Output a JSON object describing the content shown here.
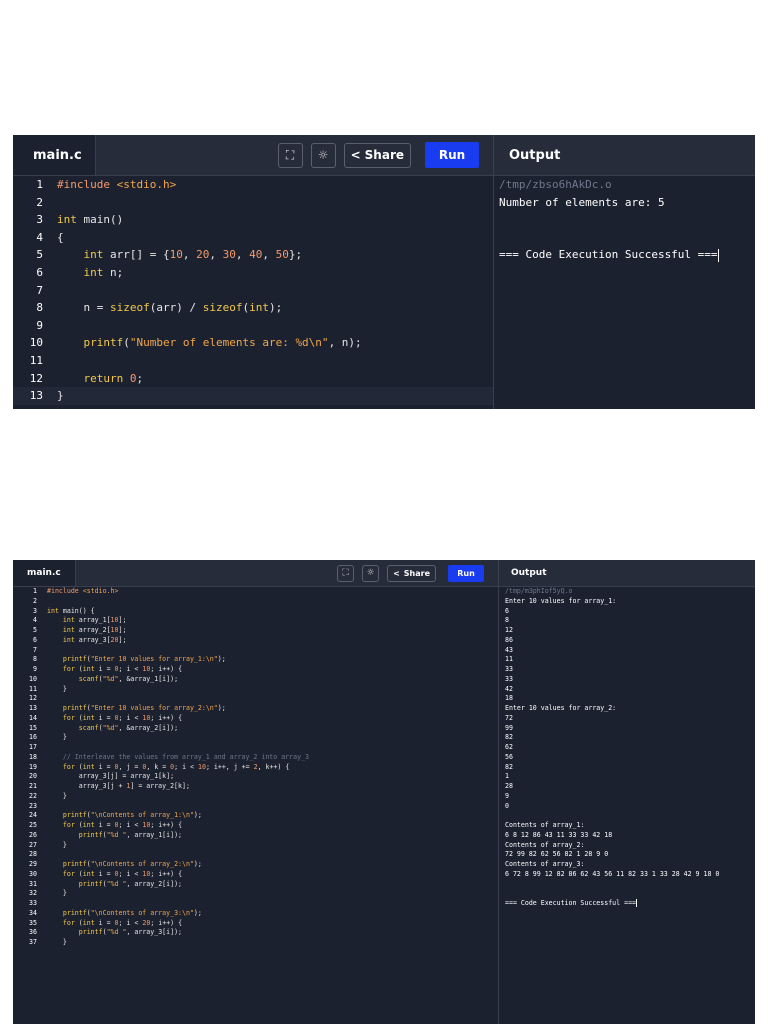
{
  "screenshot_1": {
    "file_tab": "main.c",
    "fullscreen_icon": "⛶",
    "theme_icon": "☼",
    "share_label": "Share",
    "run_label": "Run",
    "output_title": "Output",
    "code": [
      {
        "n": "1",
        "t": [
          [
            "inc",
            "#include "
          ],
          [
            "str",
            "<stdio.h>"
          ]
        ]
      },
      {
        "n": "2",
        "t": []
      },
      {
        "n": "3",
        "t": [
          [
            "kw",
            "int "
          ],
          [
            "code",
            "main()"
          ]
        ]
      },
      {
        "n": "4",
        "t": [
          [
            "code",
            "{"
          ]
        ]
      },
      {
        "n": "5",
        "t": [
          [
            "code",
            "    "
          ],
          [
            "kw",
            "int "
          ],
          [
            "code",
            "arr[] = {"
          ],
          [
            "num",
            "10"
          ],
          [
            "code",
            ", "
          ],
          [
            "num",
            "20"
          ],
          [
            "code",
            ", "
          ],
          [
            "num",
            "30"
          ],
          [
            "code",
            ", "
          ],
          [
            "num",
            "40"
          ],
          [
            "code",
            ", "
          ],
          [
            "num",
            "50"
          ],
          [
            "code",
            "};"
          ]
        ]
      },
      {
        "n": "6",
        "t": [
          [
            "code",
            "    "
          ],
          [
            "kw",
            "int "
          ],
          [
            "code",
            "n;"
          ]
        ]
      },
      {
        "n": "7",
        "t": []
      },
      {
        "n": "8",
        "t": [
          [
            "code",
            "    n = "
          ],
          [
            "kw",
            "sizeof"
          ],
          [
            "code",
            "(arr) / "
          ],
          [
            "kw",
            "sizeof"
          ],
          [
            "code",
            "("
          ],
          [
            "kw",
            "int"
          ],
          [
            "code",
            ");"
          ]
        ]
      },
      {
        "n": "9",
        "t": []
      },
      {
        "n": "10",
        "t": [
          [
            "code",
            "    "
          ],
          [
            "kw",
            "printf"
          ],
          [
            "code",
            "("
          ],
          [
            "str",
            "\"Number of elements are: %d\\n\""
          ],
          [
            "code",
            ", n);"
          ]
        ]
      },
      {
        "n": "11",
        "t": []
      },
      {
        "n": "12",
        "t": [
          [
            "code",
            "    "
          ],
          [
            "kw",
            "return "
          ],
          [
            "num",
            "0"
          ],
          [
            "code",
            ";"
          ]
        ]
      },
      {
        "n": "13",
        "t": [
          [
            "code",
            "}"
          ]
        ]
      }
    ],
    "output": [
      {
        "t": "/tmp/zbso6hAkDc.o",
        "path": true
      },
      {
        "t": "Number of elements are: 5"
      },
      {
        "t": ""
      },
      {
        "t": ""
      },
      {
        "t": "=== Code Execution Successful ===",
        "cursor": true
      }
    ]
  },
  "screenshot_2": {
    "file_tab": "main.c",
    "fullscreen_icon": "⛶",
    "theme_icon": "☼",
    "share_label": "Share",
    "run_label": "Run",
    "output_title": "Output",
    "code": [
      {
        "n": "1",
        "t": [
          [
            "inc",
            "#include "
          ],
          [
            "str",
            "<stdio.h>"
          ]
        ]
      },
      {
        "n": "2",
        "t": []
      },
      {
        "n": "3",
        "t": [
          [
            "kw",
            "int "
          ],
          [
            "code",
            "main() {"
          ]
        ]
      },
      {
        "n": "4",
        "t": [
          [
            "code",
            "    "
          ],
          [
            "kw",
            "int "
          ],
          [
            "code",
            "array_1["
          ],
          [
            "num",
            "10"
          ],
          [
            "code",
            "];"
          ]
        ]
      },
      {
        "n": "5",
        "t": [
          [
            "code",
            "    "
          ],
          [
            "kw",
            "int "
          ],
          [
            "code",
            "array_2["
          ],
          [
            "num",
            "10"
          ],
          [
            "code",
            "];"
          ]
        ]
      },
      {
        "n": "6",
        "t": [
          [
            "code",
            "    "
          ],
          [
            "kw",
            "int "
          ],
          [
            "code",
            "array_3["
          ],
          [
            "num",
            "20"
          ],
          [
            "code",
            "];"
          ]
        ]
      },
      {
        "n": "7",
        "t": []
      },
      {
        "n": "8",
        "t": [
          [
            "code",
            "    "
          ],
          [
            "kw",
            "printf"
          ],
          [
            "code",
            "("
          ],
          [
            "str",
            "\"Enter 10 values for array_1:\\n\""
          ],
          [
            "code",
            ");"
          ]
        ]
      },
      {
        "n": "9",
        "t": [
          [
            "code",
            "    "
          ],
          [
            "kw",
            "for "
          ],
          [
            "code",
            "("
          ],
          [
            "kw",
            "int "
          ],
          [
            "code",
            "i = "
          ],
          [
            "num",
            "0"
          ],
          [
            "code",
            "; i < "
          ],
          [
            "num",
            "10"
          ],
          [
            "code",
            "; i++) {"
          ]
        ]
      },
      {
        "n": "10",
        "t": [
          [
            "code",
            "        "
          ],
          [
            "kw",
            "scanf"
          ],
          [
            "code",
            "("
          ],
          [
            "str",
            "\"%d\""
          ],
          [
            "code",
            ", &array_1[i]);"
          ]
        ]
      },
      {
        "n": "11",
        "t": [
          [
            "code",
            "    }"
          ]
        ]
      },
      {
        "n": "12",
        "t": []
      },
      {
        "n": "13",
        "t": [
          [
            "code",
            "    "
          ],
          [
            "kw",
            "printf"
          ],
          [
            "code",
            "("
          ],
          [
            "str",
            "\"Enter 10 values for array_2:\\n\""
          ],
          [
            "code",
            ");"
          ]
        ]
      },
      {
        "n": "14",
        "t": [
          [
            "code",
            "    "
          ],
          [
            "kw",
            "for "
          ],
          [
            "code",
            "("
          ],
          [
            "kw",
            "int "
          ],
          [
            "code",
            "i = "
          ],
          [
            "num",
            "0"
          ],
          [
            "code",
            "; i < "
          ],
          [
            "num",
            "10"
          ],
          [
            "code",
            "; i++) {"
          ]
        ]
      },
      {
        "n": "15",
        "t": [
          [
            "code",
            "        "
          ],
          [
            "kw",
            "scanf"
          ],
          [
            "code",
            "("
          ],
          [
            "str",
            "\"%d\""
          ],
          [
            "code",
            ", &array_2[i]);"
          ]
        ]
      },
      {
        "n": "16",
        "t": [
          [
            "code",
            "    }"
          ]
        ]
      },
      {
        "n": "17",
        "t": []
      },
      {
        "n": "18",
        "t": [
          [
            "com",
            "    // Interleave the values from array_1 and array_2 into array_3"
          ]
        ]
      },
      {
        "n": "19",
        "t": [
          [
            "code",
            "    "
          ],
          [
            "kw",
            "for "
          ],
          [
            "code",
            "("
          ],
          [
            "kw",
            "int "
          ],
          [
            "code",
            "i = "
          ],
          [
            "num",
            "0"
          ],
          [
            "code",
            ", j = "
          ],
          [
            "num",
            "0"
          ],
          [
            "code",
            ", k = "
          ],
          [
            "num",
            "0"
          ],
          [
            "code",
            "; i < "
          ],
          [
            "num",
            "10"
          ],
          [
            "code",
            "; i++, j += "
          ],
          [
            "num",
            "2"
          ],
          [
            "code",
            ", k++) {"
          ]
        ]
      },
      {
        "n": "20",
        "t": [
          [
            "code",
            "        array_3[j] = array_1[k];"
          ]
        ]
      },
      {
        "n": "21",
        "t": [
          [
            "code",
            "        array_3[j + "
          ],
          [
            "num",
            "1"
          ],
          [
            "code",
            "] = array_2[k];"
          ]
        ]
      },
      {
        "n": "22",
        "t": [
          [
            "code",
            "    }"
          ]
        ]
      },
      {
        "n": "23",
        "t": []
      },
      {
        "n": "24",
        "t": [
          [
            "code",
            "    "
          ],
          [
            "kw",
            "printf"
          ],
          [
            "code",
            "("
          ],
          [
            "str",
            "\"\\nContents of array_1:\\n\""
          ],
          [
            "code",
            ");"
          ]
        ]
      },
      {
        "n": "25",
        "t": [
          [
            "code",
            "    "
          ],
          [
            "kw",
            "for "
          ],
          [
            "code",
            "("
          ],
          [
            "kw",
            "int "
          ],
          [
            "code",
            "i = "
          ],
          [
            "num",
            "0"
          ],
          [
            "code",
            "; i < "
          ],
          [
            "num",
            "10"
          ],
          [
            "code",
            "; i++) {"
          ]
        ]
      },
      {
        "n": "26",
        "t": [
          [
            "code",
            "        "
          ],
          [
            "kw",
            "printf"
          ],
          [
            "code",
            "("
          ],
          [
            "str",
            "\"%d \""
          ],
          [
            "code",
            ", array_1[i]);"
          ]
        ]
      },
      {
        "n": "27",
        "t": [
          [
            "code",
            "    }"
          ]
        ]
      },
      {
        "n": "28",
        "t": []
      },
      {
        "n": "29",
        "t": [
          [
            "code",
            "    "
          ],
          [
            "kw",
            "printf"
          ],
          [
            "code",
            "("
          ],
          [
            "str",
            "\"\\nContents of array_2:\\n\""
          ],
          [
            "code",
            ");"
          ]
        ]
      },
      {
        "n": "30",
        "t": [
          [
            "code",
            "    "
          ],
          [
            "kw",
            "for "
          ],
          [
            "code",
            "("
          ],
          [
            "kw",
            "int "
          ],
          [
            "code",
            "i = "
          ],
          [
            "num",
            "0"
          ],
          [
            "code",
            "; i < "
          ],
          [
            "num",
            "10"
          ],
          [
            "code",
            "; i++) {"
          ]
        ]
      },
      {
        "n": "31",
        "t": [
          [
            "code",
            "        "
          ],
          [
            "kw",
            "printf"
          ],
          [
            "code",
            "("
          ],
          [
            "str",
            "\"%d \""
          ],
          [
            "code",
            ", array_2[i]);"
          ]
        ]
      },
      {
        "n": "32",
        "t": [
          [
            "code",
            "    }"
          ]
        ]
      },
      {
        "n": "33",
        "t": []
      },
      {
        "n": "34",
        "t": [
          [
            "code",
            "    "
          ],
          [
            "kw",
            "printf"
          ],
          [
            "code",
            "("
          ],
          [
            "str",
            "\"\\nContents of array_3:\\n\""
          ],
          [
            "code",
            ");"
          ]
        ]
      },
      {
        "n": "35",
        "t": [
          [
            "code",
            "    "
          ],
          [
            "kw",
            "for "
          ],
          [
            "code",
            "("
          ],
          [
            "kw",
            "int "
          ],
          [
            "code",
            "i = "
          ],
          [
            "num",
            "0"
          ],
          [
            "code",
            "; i < "
          ],
          [
            "num",
            "20"
          ],
          [
            "code",
            "; i++) {"
          ]
        ]
      },
      {
        "n": "36",
        "t": [
          [
            "code",
            "        "
          ],
          [
            "kw",
            "printf"
          ],
          [
            "code",
            "("
          ],
          [
            "str",
            "\"%d \""
          ],
          [
            "code",
            ", array_3[i]);"
          ]
        ]
      },
      {
        "n": "37",
        "t": [
          [
            "code",
            "    }"
          ]
        ]
      }
    ],
    "output": [
      {
        "t": "/tmp/m3phIof5yQ.o",
        "path": true
      },
      {
        "t": "Enter 10 values for array_1:"
      },
      {
        "t": "6"
      },
      {
        "t": "8"
      },
      {
        "t": "12"
      },
      {
        "t": "86"
      },
      {
        "t": "43"
      },
      {
        "t": "11"
      },
      {
        "t": "33"
      },
      {
        "t": "33"
      },
      {
        "t": "42"
      },
      {
        "t": "18"
      },
      {
        "t": "Enter 10 values for array_2:"
      },
      {
        "t": "72"
      },
      {
        "t": "99"
      },
      {
        "t": "82"
      },
      {
        "t": "62"
      },
      {
        "t": "56"
      },
      {
        "t": "82"
      },
      {
        "t": "1"
      },
      {
        "t": "28"
      },
      {
        "t": "9"
      },
      {
        "t": "0"
      },
      {
        "t": ""
      },
      {
        "t": "Contents of array_1:"
      },
      {
        "t": "6 8 12 86 43 11 33 33 42 18"
      },
      {
        "t": "Contents of array_2:"
      },
      {
        "t": "72 99 82 62 56 82 1 28 9 0"
      },
      {
        "t": "Contents of array_3:"
      },
      {
        "t": "6 72 8 99 12 82 86 62 43 56 11 82 33 1 33 28 42 9 18 0"
      },
      {
        "t": ""
      },
      {
        "t": ""
      },
      {
        "t": "=== Code Execution Successful ===",
        "cursor": true
      }
    ]
  },
  "colors": {
    "accent": "#1a3cf0",
    "keyword": "#f2c94c",
    "string": "#f2a64a",
    "number": "#f59a6a",
    "background": "#1c2130"
  }
}
